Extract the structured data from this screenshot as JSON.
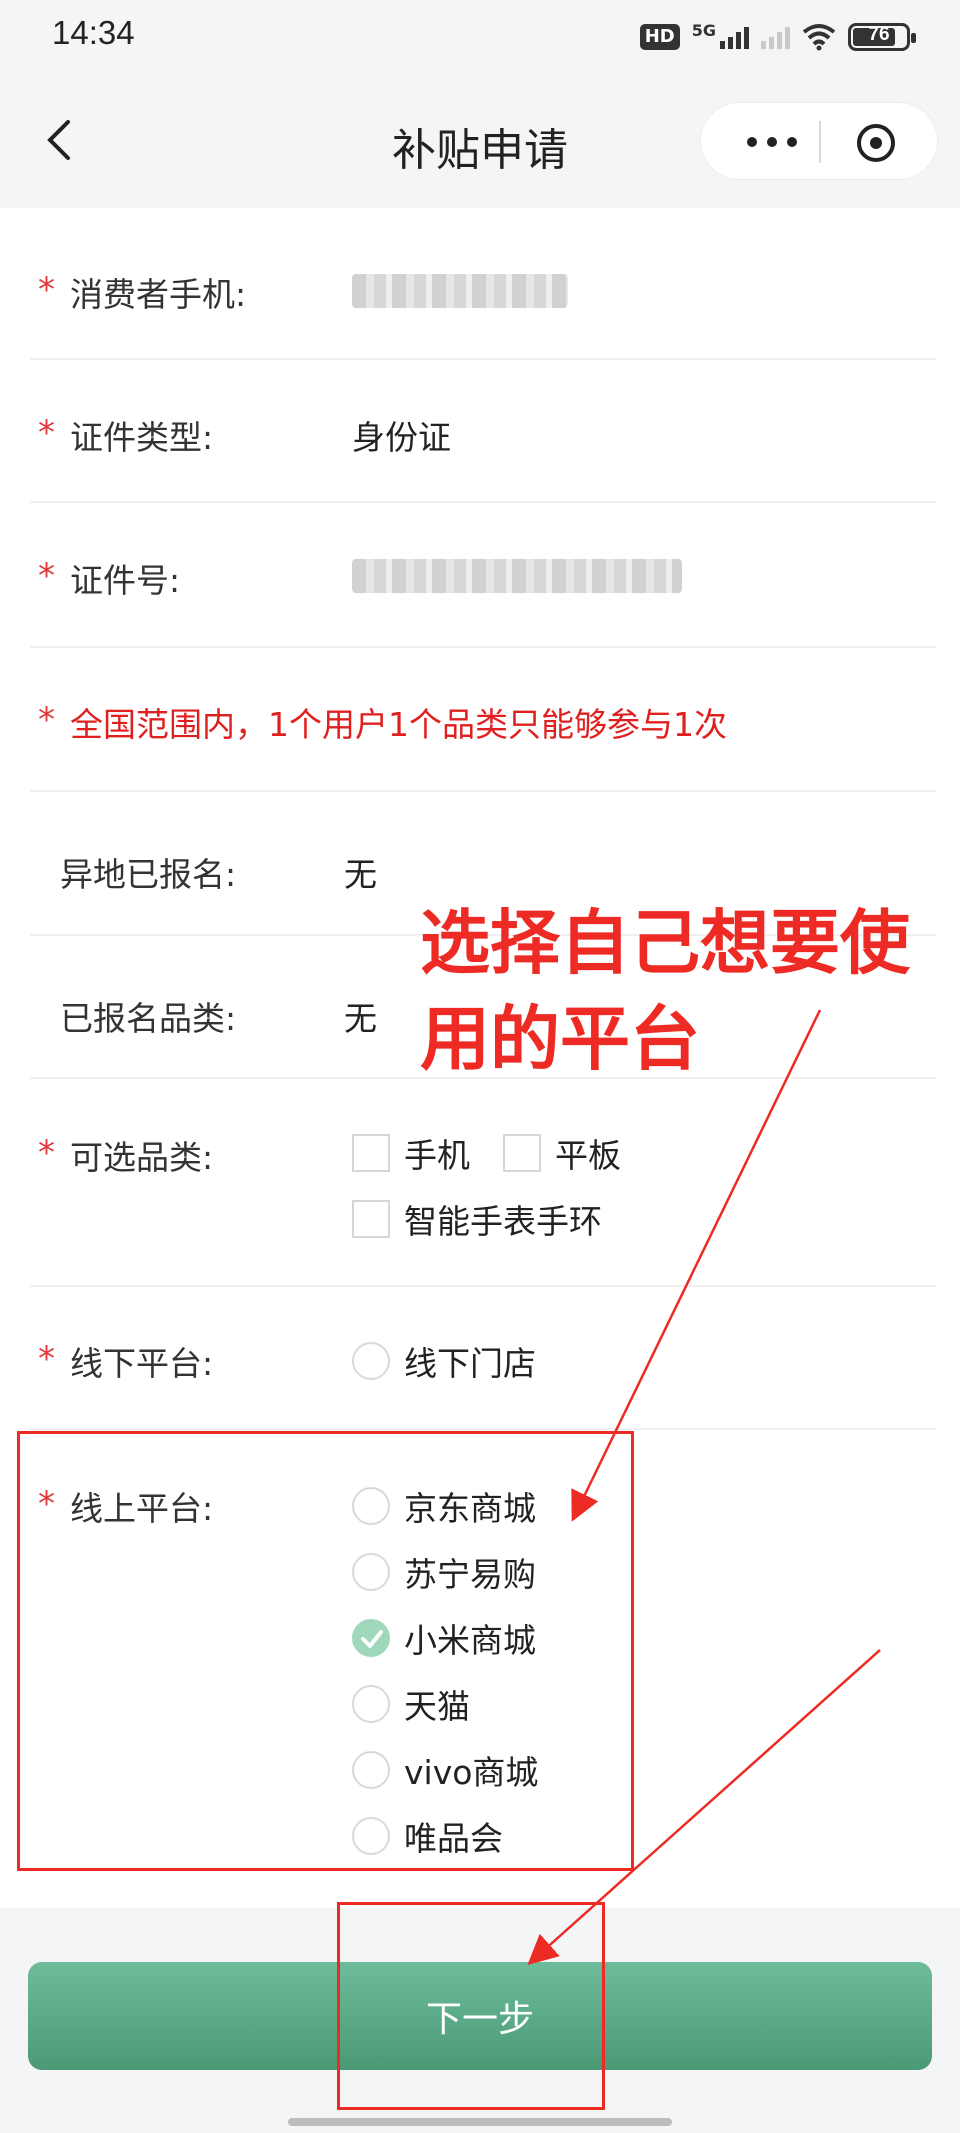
{
  "status_bar": {
    "time": "14:34",
    "hd_label": "HD",
    "network": "5G",
    "battery": "76"
  },
  "nav": {
    "title": "补贴申请",
    "back_icon": "chevron-left-icon",
    "more_icon": "more-dots-icon",
    "close_icon": "close-circle-icon"
  },
  "form": {
    "required_mark": "*",
    "phone_label": "消费者手机:",
    "id_type_label": "证件类型:",
    "id_type_value": "身份证",
    "id_no_label": "证件号:",
    "notice": "全国范围内，1个用户1个品类只能够参与1次",
    "remote_registered_label": "异地已报名:",
    "remote_registered_value": "无",
    "registered_category_label": "已报名品类:",
    "registered_category_value": "无",
    "category_label": "可选品类:",
    "categories": [
      "手机",
      "平板",
      "智能手表手环"
    ],
    "offline_label": "线下平台:",
    "offline_options": [
      "线下门店"
    ],
    "online_label": "线上平台:",
    "online_options": [
      "京东商城",
      "苏宁易购",
      "小米商城",
      "天猫",
      "vivo商城",
      "唯品会"
    ],
    "online_selected": "小米商城"
  },
  "annotation": {
    "text_line1": "选择自己想要使",
    "text_line2": "用的平台",
    "color": "#ee2a24"
  },
  "footer": {
    "next_label": "下一步",
    "button_color": "#5aab87"
  }
}
